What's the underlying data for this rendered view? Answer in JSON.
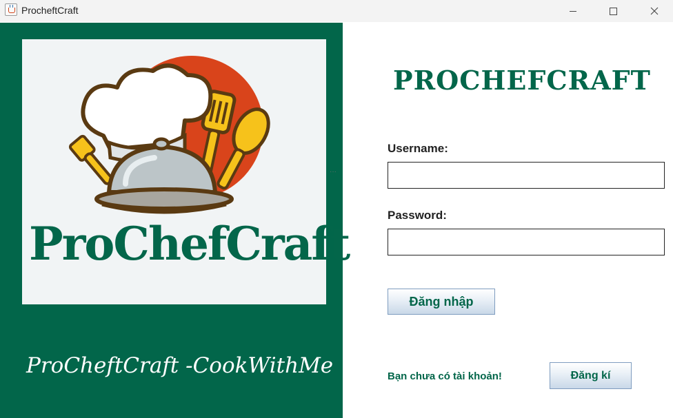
{
  "window": {
    "title": "ProcheftCraft",
    "controls": {
      "minimize_icon": "minimize-icon",
      "maximize_icon": "maximize-icon",
      "close_icon": "close-icon"
    }
  },
  "left_panel": {
    "logo": {
      "text": "ProChefCraft",
      "icon": "chef-hat-cloche-icon",
      "colors": {
        "background": "#f1f4f5",
        "circle": "#d9441b",
        "utensils": "#f6c21b",
        "text": "#03664a"
      }
    },
    "slogan": "ProCheftCraft -CookWithMe",
    "background": "#02664a"
  },
  "right_panel": {
    "brand_title": "PROCHEFCRAFT",
    "username": {
      "label": "Username:",
      "value": "",
      "placeholder": ""
    },
    "password": {
      "label": "Password:",
      "value": "",
      "placeholder": ""
    },
    "login_button": "Đăng nhập",
    "no_account_text": "Bạn chưa có tài khoản!",
    "register_button": "Đăng kí"
  },
  "colors": {
    "accent_green": "#03664a",
    "button_border": "#7e9cbf"
  }
}
